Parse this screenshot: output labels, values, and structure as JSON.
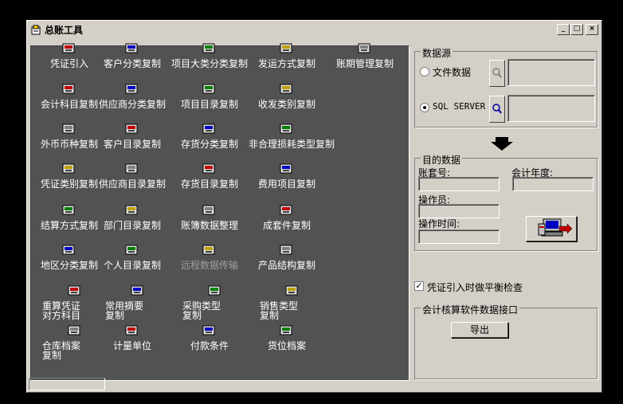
{
  "window": {
    "title": "总账工具",
    "min": "_",
    "max": "□",
    "close": "×"
  },
  "tools": [
    {
      "label": "凭证引入",
      "icon": "voucher-import-icon"
    },
    {
      "label": "客户分类复制",
      "icon": "customer-category-copy-icon"
    },
    {
      "label": "项目大类分类复制",
      "icon": "project-class-copy-icon"
    },
    {
      "label": "发运方式复制",
      "icon": "shipping-method-copy-icon"
    },
    {
      "label": "账期管理复制",
      "icon": "period-management-copy-icon"
    },
    {
      "label": "会计科目复制",
      "icon": "account-subject-copy-icon"
    },
    {
      "label": "供应商分类复制",
      "icon": "supplier-category-copy-icon"
    },
    {
      "label": "项目目录复制",
      "icon": "project-catalog-copy-icon"
    },
    {
      "label": "收发类别复制",
      "icon": "receive-send-category-copy-icon"
    },
    {
      "label": "外币币种复制",
      "icon": "foreign-currency-copy-icon"
    },
    {
      "label": "客户目录复制",
      "icon": "customer-catalog-copy-icon"
    },
    {
      "label": "存货分类复制",
      "icon": "inventory-category-copy-icon"
    },
    {
      "label": "非合理损耗类型复制",
      "icon": "loss-type-copy-icon"
    },
    {
      "label": "凭证类别复制",
      "icon": "voucher-type-copy-icon"
    },
    {
      "label": "供应商目录复制",
      "icon": "supplier-catalog-copy-icon"
    },
    {
      "label": "存货目录复制",
      "icon": "inventory-catalog-copy-icon"
    },
    {
      "label": "费用项目复制",
      "icon": "expense-item-copy-icon"
    },
    {
      "label": "结算方式复制",
      "icon": "settlement-method-copy-icon"
    },
    {
      "label": "部门目录复制",
      "icon": "department-catalog-copy-icon"
    },
    {
      "label": "账簿数据整理",
      "icon": "ledger-data-cleanup-icon"
    },
    {
      "label": "成套件复制",
      "icon": "kit-copy-icon"
    },
    {
      "label": "地区分类复制",
      "icon": "region-category-copy-icon"
    },
    {
      "label": "个人目录复制",
      "icon": "personal-catalog-copy-icon"
    },
    {
      "label": "远程数据传输",
      "icon": "remote-transfer-icon",
      "disabled": true
    },
    {
      "label": "产品结构复制",
      "icon": "product-structure-copy-icon"
    },
    {
      "label": "重算凭证",
      "label2": "对方科目",
      "icon": "recalc-voucher-icon"
    },
    {
      "label": "常用摘要",
      "label2": "复制",
      "icon": "common-summary-copy-icon"
    },
    {
      "label": "采购类型",
      "label2": "复制",
      "icon": "purchase-type-copy-icon"
    },
    {
      "label": "销售类型",
      "label2": "复制",
      "icon": "sales-type-copy-icon"
    },
    {
      "label": "仓库档案",
      "label2": "复制",
      "icon": "warehouse-archive-copy-icon"
    },
    {
      "label": "计量单位",
      "icon": "unit-of-measure-icon"
    },
    {
      "label": "付款条件",
      "icon": "payment-terms-icon"
    },
    {
      "label": "货位档案",
      "icon": "location-archive-icon"
    }
  ],
  "source": {
    "title": "数据源",
    "option_file": "文件数据",
    "option_sql": "SQL SERVER",
    "selected": "SQL SERVER"
  },
  "target": {
    "title": "目的数据",
    "account_set_label": "账套号:",
    "fiscal_year_label": "会计年度:",
    "operator_label": "操作员:",
    "op_time_label": "操作时间:"
  },
  "balance_check": {
    "label": "凭证引入时做平衡检查",
    "checked": true
  },
  "interface": {
    "title": "会计核算软件数据接口",
    "export_label": "导出"
  }
}
